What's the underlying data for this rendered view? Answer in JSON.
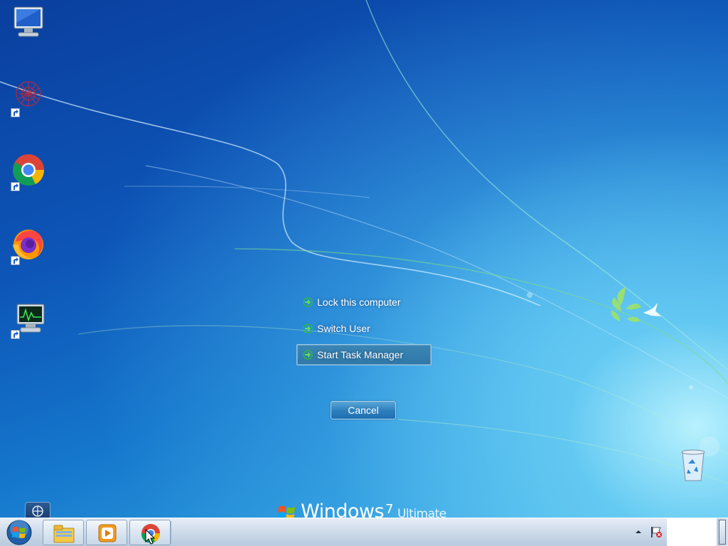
{
  "screen": {
    "background": "#1a6fc4",
    "accent": "#2f78a8"
  },
  "desktop_icons": [
    {
      "name": "computer-icon",
      "shortcut": false
    },
    {
      "name": "network-app-icon",
      "shortcut": true
    },
    {
      "name": "chrome-icon",
      "shortcut": true
    },
    {
      "name": "firefox-icon",
      "shortcut": true
    },
    {
      "name": "system-monitor-icon",
      "shortcut": true
    }
  ],
  "security_menu": {
    "items": [
      {
        "label": "Lock this computer",
        "selected": false
      },
      {
        "label": "Switch User",
        "selected": false
      },
      {
        "label": "Start Task Manager",
        "selected": true
      }
    ],
    "cancel_label": "Cancel"
  },
  "branding": {
    "product": "Windows",
    "version": "7",
    "edition": "Ultimate"
  },
  "taskbar": {
    "pinned": [
      {
        "name": "windows-explorer-icon"
      },
      {
        "name": "media-player-icon"
      },
      {
        "name": "chrome-icon"
      }
    ],
    "tray": [
      "show-hidden-icons-arrow",
      "action-center-flag-icon"
    ]
  }
}
